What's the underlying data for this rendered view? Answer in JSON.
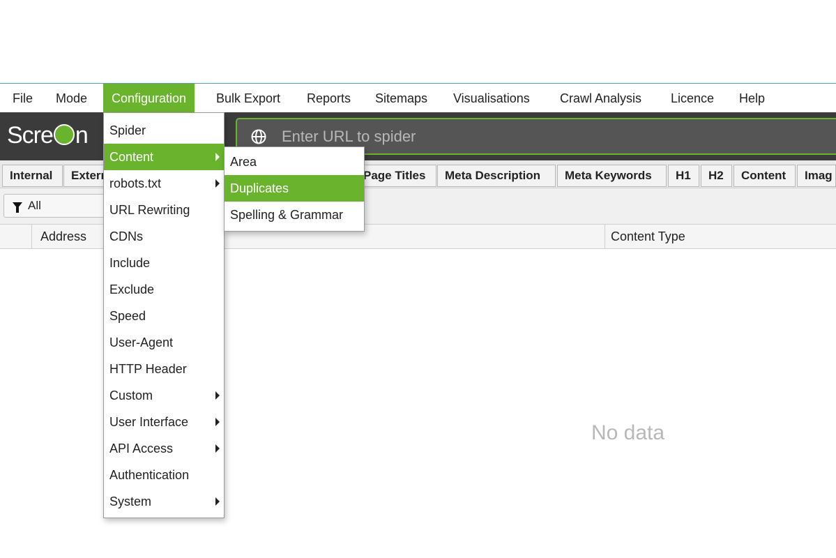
{
  "menubar": {
    "items": [
      "File",
      "Mode",
      "Configuration",
      "Bulk Export",
      "Reports",
      "Sitemaps",
      "Visualisations",
      "Crawl Analysis",
      "Licence",
      "Help"
    ],
    "active": "Configuration"
  },
  "toolbar": {
    "logo_text_left": "Scre",
    "logo_text_right": "n",
    "url_placeholder": "Enter URL to spider"
  },
  "tabs": {
    "items": [
      "Internal",
      "Extern",
      "Page Titles",
      "Meta Description",
      "Meta Keywords",
      "H1",
      "H2",
      "Content",
      "Imag"
    ]
  },
  "filter": {
    "label": "All"
  },
  "table": {
    "columns": [
      "Address",
      "Content Type"
    ],
    "empty_text": "No data"
  },
  "config_menu": {
    "items": [
      {
        "label": "Spider",
        "submenu": false
      },
      {
        "label": "Content",
        "submenu": true,
        "active": true
      },
      {
        "label": "robots.txt",
        "submenu": true
      },
      {
        "label": "URL Rewriting",
        "submenu": false
      },
      {
        "label": "CDNs",
        "submenu": false
      },
      {
        "label": "Include",
        "submenu": false
      },
      {
        "label": "Exclude",
        "submenu": false
      },
      {
        "label": "Speed",
        "submenu": false
      },
      {
        "label": "User-Agent",
        "submenu": false
      },
      {
        "label": "HTTP Header",
        "submenu": false
      },
      {
        "label": "Custom",
        "submenu": true
      },
      {
        "label": "User Interface",
        "submenu": true
      },
      {
        "label": "API Access",
        "submenu": true
      },
      {
        "label": "Authentication",
        "submenu": false
      },
      {
        "label": "System",
        "submenu": true
      }
    ]
  },
  "content_submenu": {
    "items": [
      {
        "label": "Area"
      },
      {
        "label": "Duplicates",
        "active": true
      },
      {
        "label": "Spelling & Grammar"
      }
    ]
  },
  "colors": {
    "accent": "#6ab42d",
    "toolbar_bg": "#3b3b3b"
  }
}
